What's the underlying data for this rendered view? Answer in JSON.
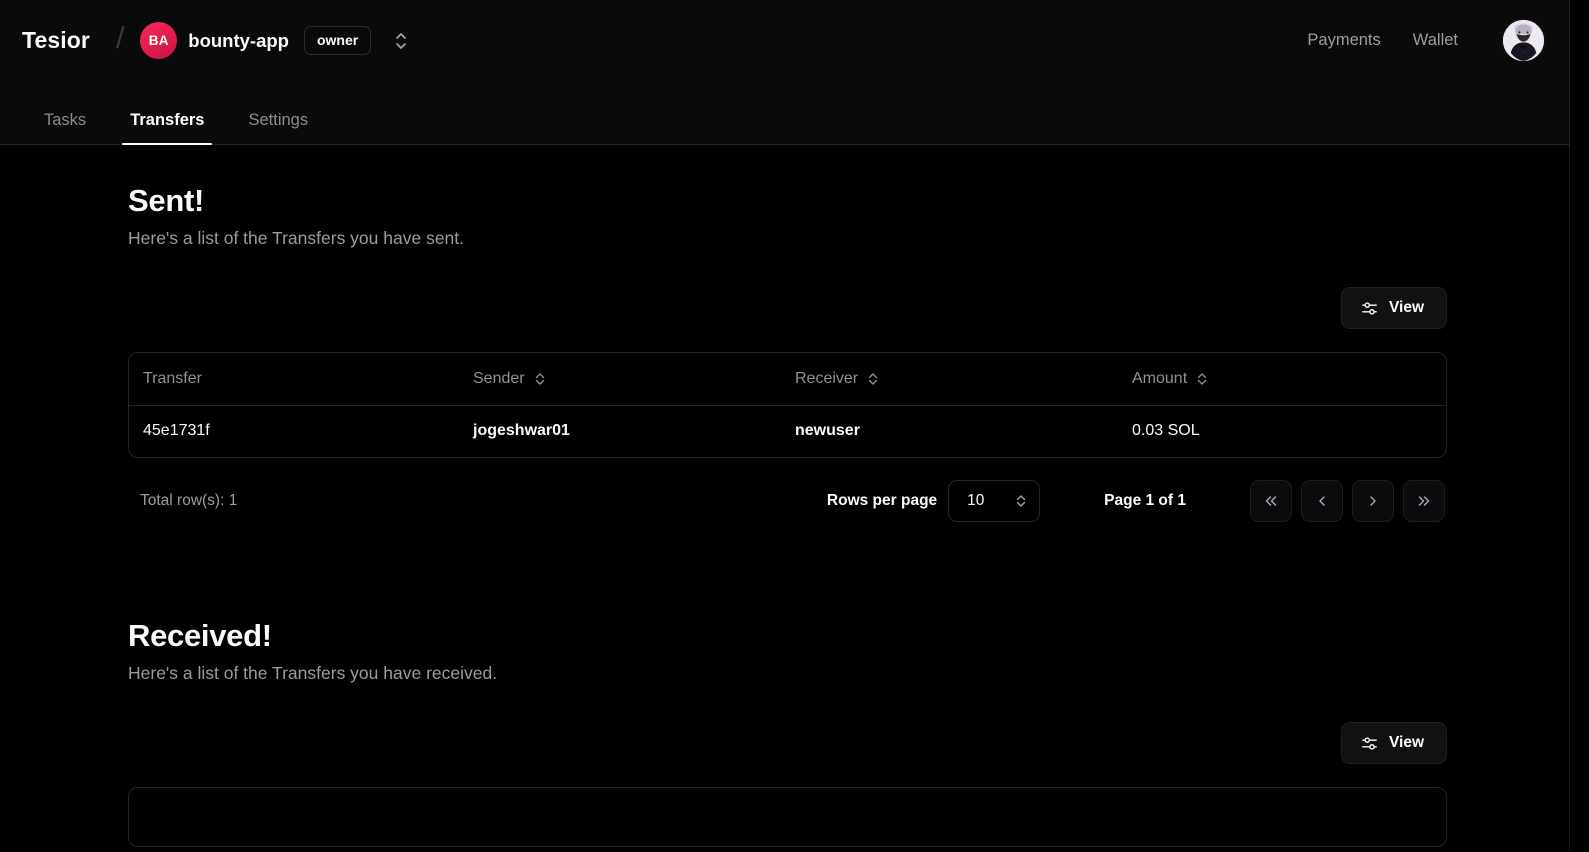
{
  "topbar": {
    "brand": "Tesior",
    "separator": "/",
    "org": {
      "initials": "BA",
      "name": "bounty-app",
      "role": "owner"
    },
    "nav": [
      {
        "label": "Payments"
      },
      {
        "label": "Wallet"
      }
    ],
    "avatar_alt": "user-avatar"
  },
  "tabs": [
    {
      "label": "Tasks",
      "active": false
    },
    {
      "label": "Transfers",
      "active": true
    },
    {
      "label": "Settings",
      "active": false
    }
  ],
  "sections": [
    {
      "title": "Sent!",
      "description": "Here's a list of the Transfers you have sent.",
      "view_button": "View",
      "columns": [
        {
          "key": "transfer",
          "label": "Transfer",
          "sortable": false
        },
        {
          "key": "sender",
          "label": "Sender",
          "sortable": true
        },
        {
          "key": "receiver",
          "label": "Receiver",
          "sortable": true
        },
        {
          "key": "amount",
          "label": "Amount",
          "sortable": true
        }
      ],
      "rows": [
        {
          "transfer": "45e1731f",
          "sender": "jogeshwar01",
          "receiver": "newuser",
          "amount": "0.03 SOL"
        }
      ],
      "pagination": {
        "total_rows": "Total row(s): 1",
        "rows_per_page_label": "Rows per page",
        "rows_per_page_value": "10",
        "page_indicator": "Page 1 of 1",
        "first_page": "«",
        "prev_page": "‹",
        "next_page": "›",
        "last_page": "»"
      }
    },
    {
      "title": "Received!",
      "description": "Here's a list of the Transfers you have received.",
      "view_button": "View"
    }
  ],
  "colors": {
    "brand_accent": "#e11d48",
    "background": "#000000",
    "surface": "#0a0a0a",
    "border": "#222227",
    "text_primary": "#fafafa",
    "text_muted": "#9b9ba2"
  }
}
